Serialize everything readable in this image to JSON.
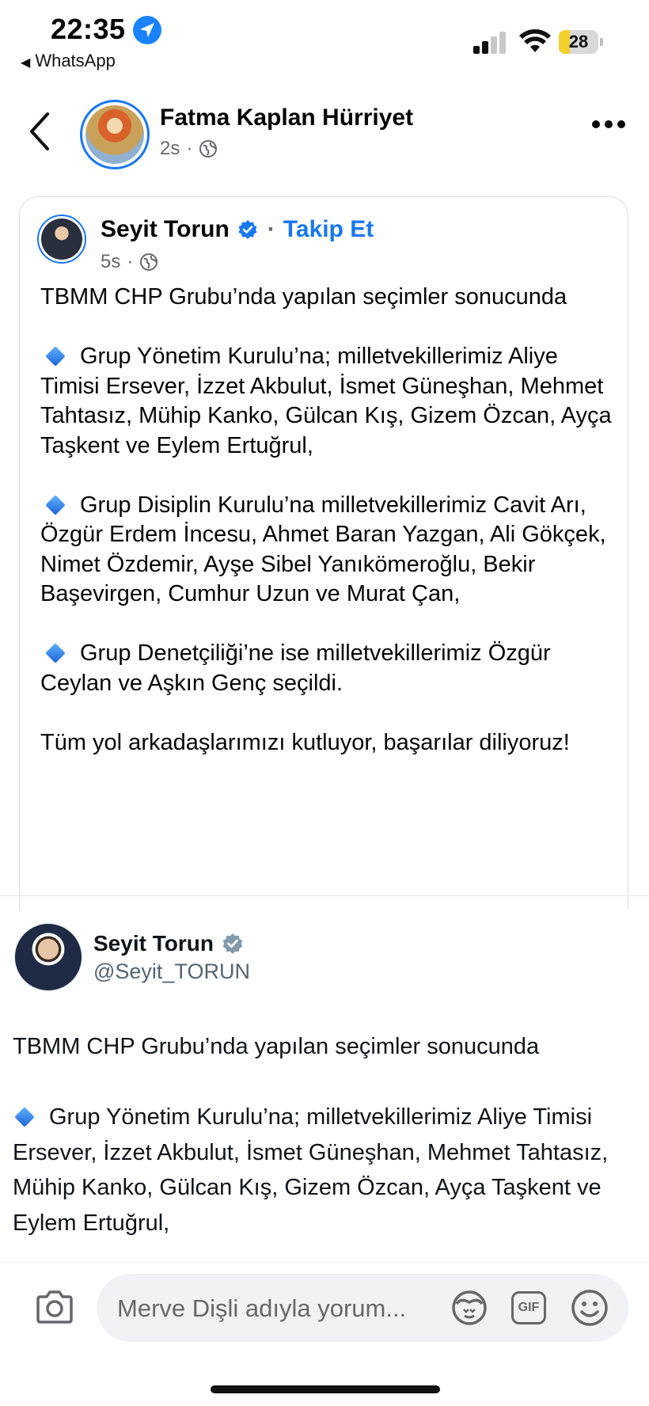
{
  "status_bar": {
    "time": "22:35",
    "back_app": "WhatsApp",
    "battery": "28",
    "battery_level": 0.28,
    "icons": [
      "location-arrow-icon",
      "signal-icon",
      "wifi-icon",
      "battery-icon"
    ]
  },
  "post": {
    "author": "Fatma Kaplan Hürriyet",
    "time": "2s",
    "separator": "·",
    "audience_icon": "globe-icon"
  },
  "shared_post": {
    "author": "Seyit Torun",
    "follow_separator": "·",
    "follow_label": "Takip Et",
    "time": "5s",
    "separator": "·",
    "paragraphs": [
      "TBMM CHP Grubu’nda yapılan seçimler sonucunda",
      "Grup Yönetim Kurulu’na; milletvekillerimiz Aliye Timisi Ersever, İzzet Akbulut, İsmet Güneşhan, Mehmet Tahtasız, Mühip Kanko, Gülcan Kış, Gizem Özcan, Ayça Taşkent ve Eylem Ertuğrul,",
      "Grup Disiplin Kurulu’na milletvekillerimiz Cavit Arı, Özgür Erdem İncesu, Ahmet Baran Yazgan, Ali Gökçek, Nimet Özdemir, Ayşe Sibel Yanıkömeroğlu, Bekir Başevirgen, Cumhur Uzun ve Murat Çan,",
      "Grup Denetçiliği’ne ise milletvekillerimiz Özgür Ceylan ve Aşkın Genç seçildi.",
      "Tüm yol arkadaşlarımızı kutluyor, başarılar diliyoruz!"
    ]
  },
  "tweet": {
    "name": "Seyit Torun",
    "handle": "@Seyit_TORUN",
    "paragraphs": [
      "TBMM CHP Grubu’nda yapılan seçimler sonucunda",
      "Grup Yönetim Kurulu’na; milletvekillerimiz Aliye Timisi Ersever, İzzet Akbulut, İsmet Güneşhan, Mehmet Tahtasız, Mühip Kanko, Gülcan Kış, Gizem Özcan, Ayça Taşkent ve Eylem Ertuğrul,"
    ]
  },
  "comment_bar": {
    "placeholder": "Merve Dişli adıyla yorum...",
    "gif_label": "GIF"
  },
  "colors": {
    "accent": "#1877f2",
    "secondary_text": "#65676b",
    "verified_twitter": "#829aab",
    "battery": "#f2d12b"
  }
}
